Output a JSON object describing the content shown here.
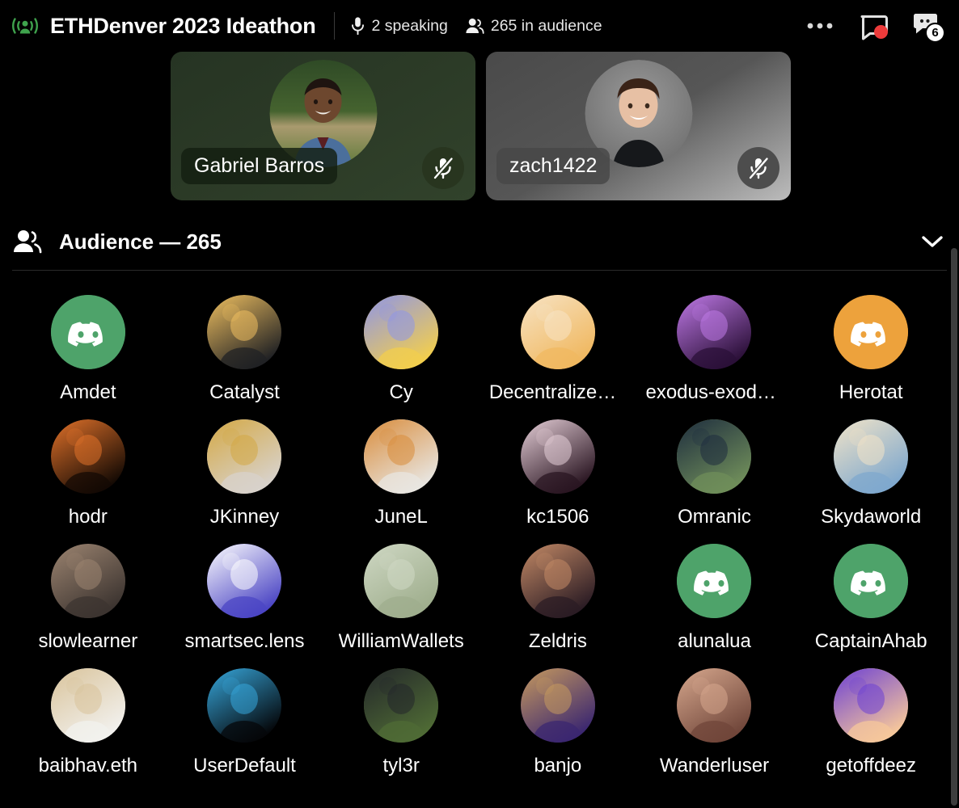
{
  "header": {
    "logo_icon": "broadcast-live-icon",
    "logo_color": "#3fa34d",
    "title": "ETHDenver 2023 Ideathon",
    "stats": [
      {
        "icon": "microphone-icon",
        "label": "2 speaking"
      },
      {
        "icon": "people-icon",
        "label": "265 in audience"
      }
    ],
    "actions": [
      {
        "icon": "more-options-icon",
        "name": "more-options-button"
      },
      {
        "icon": "screen-share-record-icon",
        "name": "screen-share-button",
        "indicator_color": "#ed3b3b"
      },
      {
        "icon": "chat-bubble-icon",
        "name": "chat-button",
        "badge": "6"
      }
    ]
  },
  "stage": {
    "speakers": [
      {
        "name": "Gabriel Barros",
        "muted": true,
        "mic_icon": "mic-muted-icon",
        "tile_theme": "green",
        "avatar_alt": "smiling man outdoors in blue shirt"
      },
      {
        "name": "zach1422",
        "muted": true,
        "mic_icon": "mic-muted-icon",
        "tile_theme": "grey",
        "avatar_alt": "smiling young man with brown hair"
      }
    ]
  },
  "audience": {
    "icon": "people-icon",
    "title": "Audience — 265",
    "count": 265,
    "collapse_icon": "chevron-down-icon",
    "members": [
      {
        "name": "Amdet",
        "avatar": "discord-logo",
        "bg": "#4ea36a",
        "fg": "#ffffff"
      },
      {
        "name": "Catalyst",
        "avatar": "anime-portrait",
        "bg": "#202124",
        "fg": "#f0c060"
      },
      {
        "name": "Cy",
        "avatar": "blue-portrait",
        "bg": "#f2ce4e",
        "fg": "#8e95e8"
      },
      {
        "name": "Decentralized…",
        "avatar": "cartoon-astronaut",
        "bg": "#f0b860",
        "fg": "#f7e3c4"
      },
      {
        "name": "exodus-exodu…",
        "avatar": "cosmic-emblem",
        "bg": "#2b1038",
        "fg": "#c07ae8"
      },
      {
        "name": "Herotat",
        "avatar": "discord-logo",
        "bg": "#eda23c",
        "fg": "#ffffff"
      },
      {
        "name": "hodr",
        "avatar": "orange-waves",
        "bg": "#140a04",
        "fg": "#e2722a"
      },
      {
        "name": "JKinney",
        "avatar": "rainbow-hair-avatar",
        "bg": "#d8d2cb",
        "fg": "#d4a843"
      },
      {
        "name": "JuneL",
        "avatar": "cat-laptop",
        "bg": "#e8e5e0",
        "fg": "#d98c3b"
      },
      {
        "name": "kc1506",
        "avatar": "night-portrait",
        "bg": "#2a1622",
        "fg": "#e6cfd8"
      },
      {
        "name": "Omranic",
        "avatar": "man-suit-outdoors",
        "bg": "#6f8d5a",
        "fg": "#1d2c3e"
      },
      {
        "name": "Skydaworld",
        "avatar": "sky-clouds",
        "bg": "#7fa8cd",
        "fg": "#f2e4c8"
      },
      {
        "name": "slowlearner",
        "avatar": "man-selfie",
        "bg": "#3c3430",
        "fg": "#9d8571"
      },
      {
        "name": "smartsec.lens",
        "avatar": "lens-logo",
        "bg": "#4b45c4",
        "fg": "#ffffff"
      },
      {
        "name": "WilliamWallets",
        "avatar": "river-landscape",
        "bg": "#9fae8d",
        "fg": "#cfd8c4"
      },
      {
        "name": "Zeldris",
        "avatar": "fantasy-warrior",
        "bg": "#2b1c24",
        "fg": "#c48a66"
      },
      {
        "name": "alunalua",
        "avatar": "discord-logo",
        "bg": "#4ea36a",
        "fg": "#ffffff"
      },
      {
        "name": "CaptainAhab",
        "avatar": "discord-logo",
        "bg": "#4ea36a",
        "fg": "#ffffff"
      },
      {
        "name": "baibhav.eth",
        "avatar": "bull-cartoon",
        "bg": "#f2f1ee",
        "fg": "#d9c39a"
      },
      {
        "name": "UserDefault",
        "avatar": "pixel-robot",
        "bg": "#05070a",
        "fg": "#37a8dd"
      },
      {
        "name": "tyl3r",
        "avatar": "man-greenery",
        "bg": "#4f6b35",
        "fg": "#23262a"
      },
      {
        "name": "banjo",
        "avatar": "tellor-mascot",
        "bg": "#3b2770",
        "fg": "#c79a5e"
      },
      {
        "name": "Wanderluser",
        "avatar": "woman-portrait",
        "bg": "#70463a",
        "fg": "#d7a88e"
      },
      {
        "name": "getoffdeez",
        "avatar": "scuba-avatar",
        "bg": "#f6c79b",
        "fg": "#6b3fd4"
      }
    ]
  },
  "scrollbar": {
    "name": "page-scrollbar",
    "color": "#3d3d3d"
  }
}
